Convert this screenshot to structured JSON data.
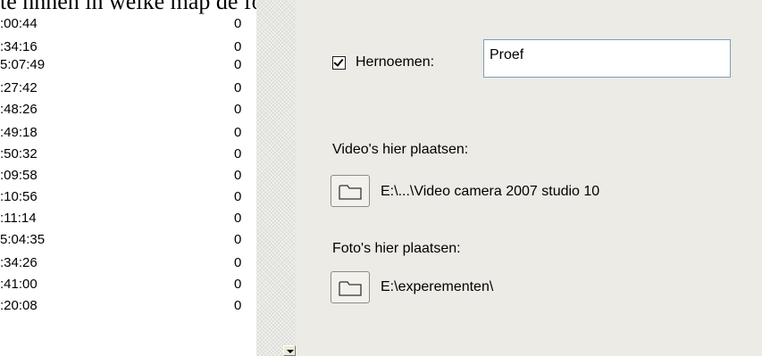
{
  "caption": "te nnnen in welke map de foto,sv video's opgeslagen k",
  "list": {
    "rows": [
      {
        "time": ":00:44",
        "count": "0"
      },
      {
        "time": ":34:16",
        "count": "0"
      },
      {
        "time": "5:07:49",
        "count": "0"
      },
      {
        "time": ":27:42",
        "count": "0"
      },
      {
        "time": ":48:26",
        "count": "0"
      },
      {
        "time": ":49:18",
        "count": "0"
      },
      {
        "time": ":50:32",
        "count": "0"
      },
      {
        "time": ":09:58",
        "count": "0"
      },
      {
        "time": ":10:56",
        "count": "0"
      },
      {
        "time": ":11:14",
        "count": "0"
      },
      {
        "time": "5:04:35",
        "count": "0"
      },
      {
        "time": ":34:26",
        "count": "0"
      },
      {
        "time": ":41:00",
        "count": "0"
      },
      {
        "time": ":20:08",
        "count": "0"
      }
    ]
  },
  "rename": {
    "checked": true,
    "label": "Hernoemen:",
    "value": "Proef"
  },
  "videos": {
    "label": "Video's hier plaatsen:",
    "path": "E:\\...\\Video camera 2007 studio 10",
    "icon": "folder-icon"
  },
  "photos": {
    "label": "Foto's hier plaatsen:",
    "path": "E:\\experementen\\",
    "icon": "folder-icon"
  }
}
